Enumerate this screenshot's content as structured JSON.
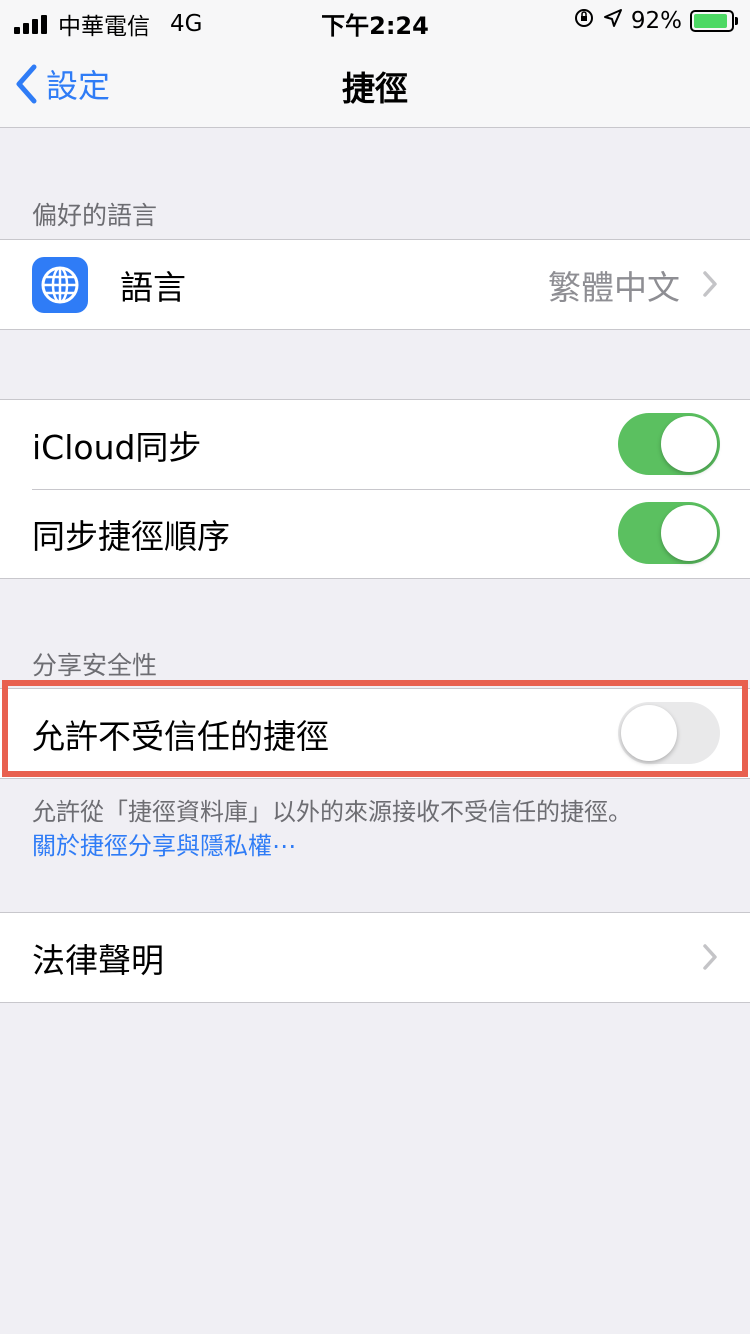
{
  "status_bar": {
    "carrier": "中華電信",
    "network": "4G",
    "time": "下午2:24",
    "battery": "92%",
    "battery_level": 0.92
  },
  "nav": {
    "back_label": "設定",
    "title": "捷徑"
  },
  "language_section": {
    "header": "偏好的語言",
    "row_label": "語言",
    "row_value": "繁體中文",
    "icon": "globe-icon"
  },
  "sync_section": {
    "icloud_label": "iCloud同步",
    "icloud_on": true,
    "order_label": "同步捷徑順序",
    "order_on": true
  },
  "security_section": {
    "header": "分享安全性",
    "untrusted_label": "允許不受信任的捷徑",
    "untrusted_on": false,
    "footer": "允許從「捷徑資料庫」以外的來源接收不受信任的捷徑。",
    "footer_link": "關於捷徑分享與隱私權⋯"
  },
  "legal_section": {
    "label": "法律聲明"
  },
  "colors": {
    "accent": "#2f7cf6",
    "toggle_on": "#5bc060",
    "highlight": "#e8604f"
  }
}
